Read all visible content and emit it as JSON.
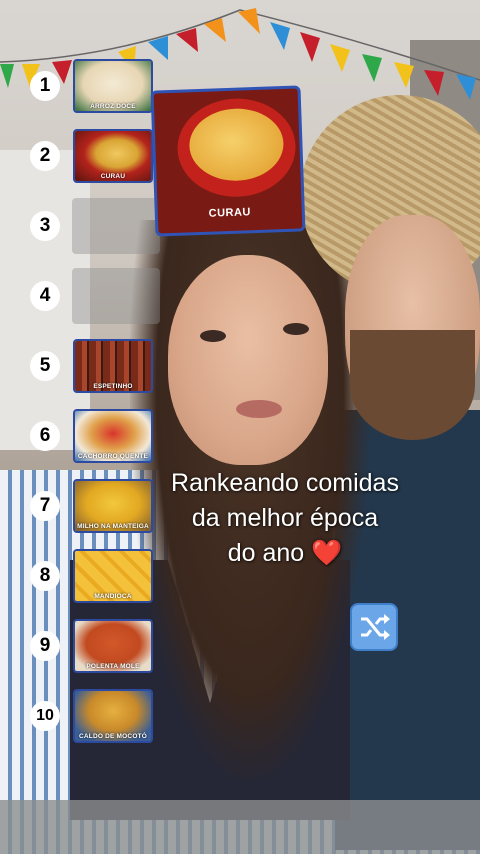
{
  "ranking": [
    {
      "rank": "1",
      "label": "ARROZ DOCE"
    },
    {
      "rank": "2",
      "label": "CURAU"
    },
    {
      "rank": "3",
      "label": ""
    },
    {
      "rank": "4",
      "label": ""
    },
    {
      "rank": "5",
      "label": "ESPETINHO"
    },
    {
      "rank": "6",
      "label": "CACHORRO QUENTE"
    },
    {
      "rank": "7",
      "label": "MILHO NA MANTEIGA"
    },
    {
      "rank": "8",
      "label": "MANDIOCA"
    },
    {
      "rank": "9",
      "label": "POLENTA MOLE"
    },
    {
      "rank": "10",
      "label": "CALDO DE MOCOTÓ"
    }
  ],
  "current_card": {
    "label": "CURAU"
  },
  "caption": {
    "line1": "Rankeando comidas",
    "line2": "da melhor época",
    "line3": "do ano",
    "emoji": "❤️"
  },
  "icons": {
    "shuffle": "shuffle-icon",
    "heart": "heart-icon"
  },
  "colors": {
    "card_border": "#2f54b5",
    "heart": "#e0202a",
    "shuffle_bg": "#6aa6e8"
  }
}
